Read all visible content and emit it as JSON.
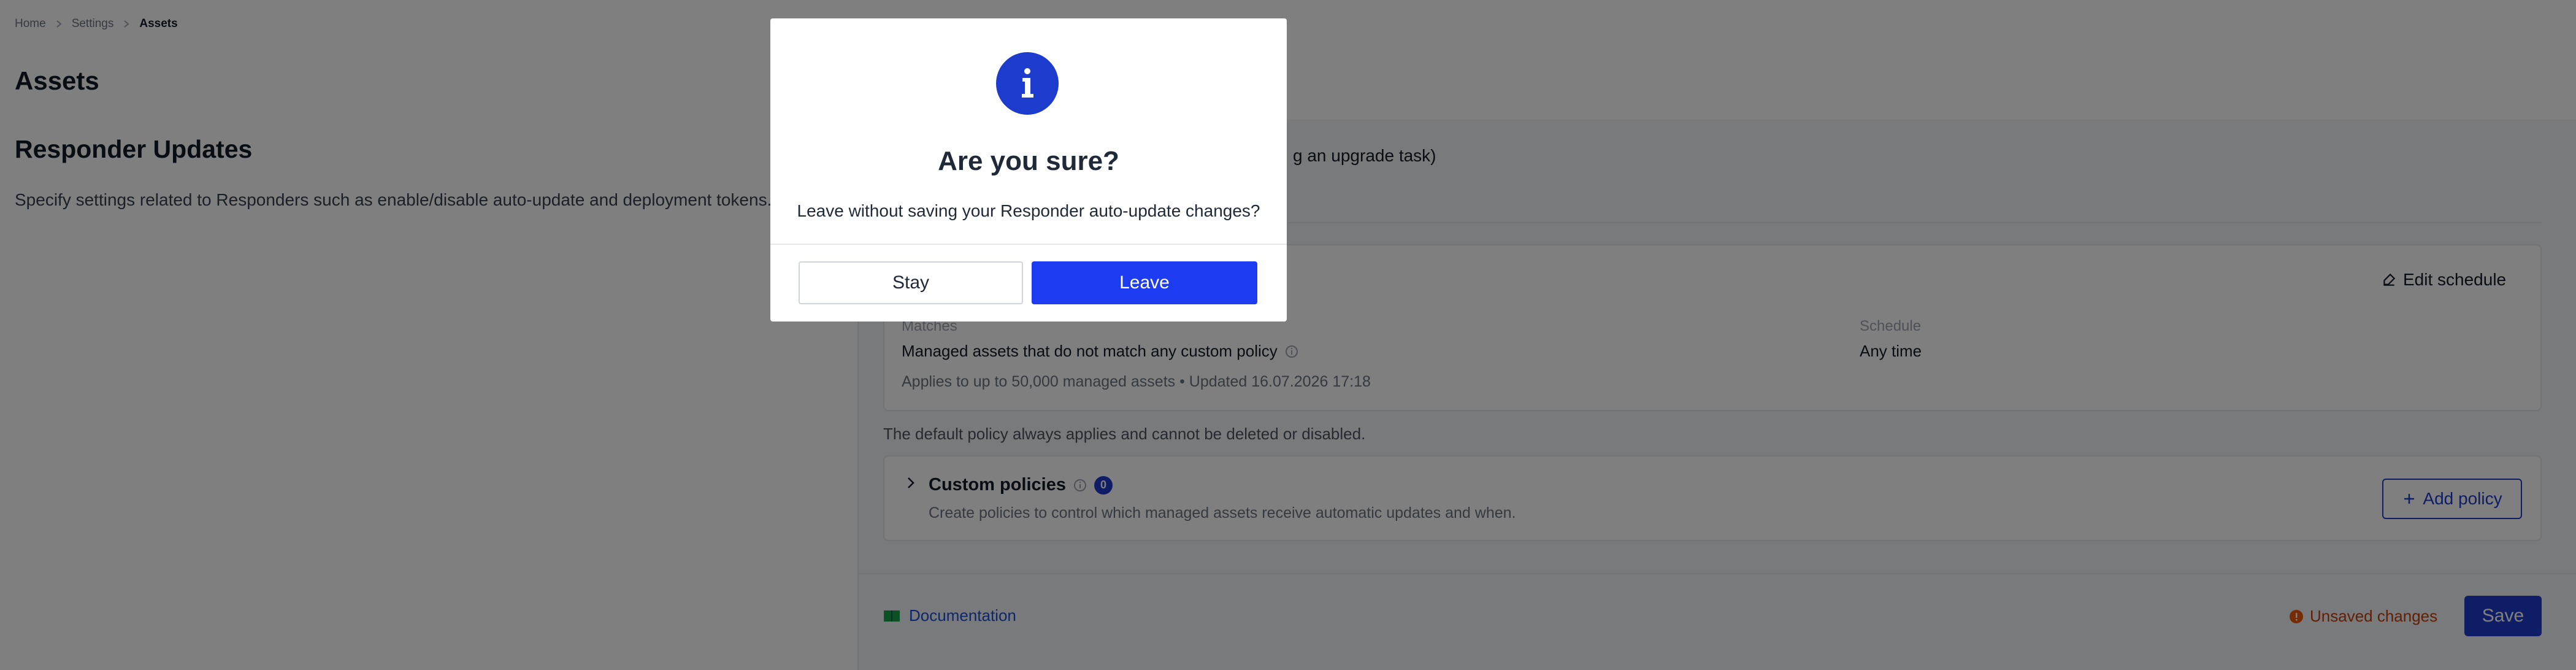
{
  "breadcrumb": {
    "items": [
      "Home",
      "Settings"
    ],
    "current": "Assets"
  },
  "page": {
    "title": "Assets"
  },
  "section": {
    "title": "Responder Updates",
    "description": "Specify settings related to Responders such as enable/disable auto-update and deployment tokens."
  },
  "panel": {
    "partial_text": "g an upgrade task)",
    "edit_schedule_label": "Edit schedule",
    "matches_label": "Matches",
    "matches_value": "Managed assets that do not match any custom policy",
    "schedule_label": "Schedule",
    "schedule_value": "Any time",
    "applies": "Applies to up to 50,000 managed assets  •  Updated 16.07.2026 17:18",
    "default_note": "The default policy always applies and cannot be deleted or disabled.",
    "custom": {
      "title": "Custom policies",
      "count": "0",
      "description": "Create policies to control which managed assets receive automatic updates and when.",
      "add_label": "Add policy"
    }
  },
  "footer": {
    "documentation_label": "Documentation",
    "unsaved_label": "Unsaved changes",
    "save_label": "Save"
  },
  "modal": {
    "title": "Are you sure?",
    "body": "Leave without saving your Responder auto-update changes?",
    "stay_label": "Stay",
    "leave_label": "Leave"
  },
  "icons": [
    "chevron-right-icon",
    "info-icon",
    "edit-icon",
    "plus-icon",
    "book-icon",
    "alert-circle-icon"
  ],
  "colors": {
    "accent": "#1d3bcc",
    "leave_button": "#1d3bf0",
    "warning": "#c2410c"
  }
}
